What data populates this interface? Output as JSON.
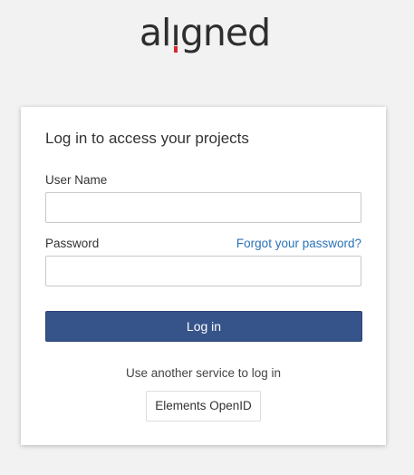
{
  "logo": {
    "text_before_i": "al",
    "text_i": "ı",
    "text_after_i": "gned",
    "accent_color": "#d7282f"
  },
  "login_form": {
    "title": "Log in to access your projects",
    "username_label": "User Name",
    "username_value": "",
    "password_label": "Password",
    "password_value": "",
    "forgot_password_link": "Forgot your password?",
    "login_button": "Log in",
    "alt_login_text": "Use another service to log in",
    "openid_button": "Elements OpenID"
  },
  "colors": {
    "primary_button": "#36548a",
    "link": "#2b73b8",
    "page_background": "#f2f2f2"
  }
}
